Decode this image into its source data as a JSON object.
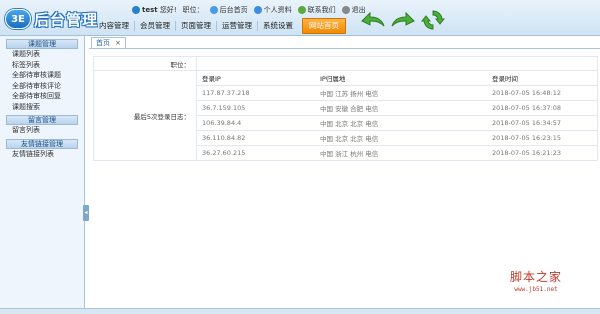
{
  "app": {
    "logo_mark": "3E",
    "logo_text": "后台管理"
  },
  "userbar": {
    "username": "test",
    "greeting": "您好!",
    "role_label": "职位：",
    "home_link": "后台首页",
    "profile_link": "个人资料",
    "contact_link": "联系我们",
    "logout_link": "退出"
  },
  "nav": {
    "items": [
      "内容管理",
      "会员管理",
      "页面管理",
      "运营管理",
      "系统设置"
    ],
    "site_button": "网站首页"
  },
  "toolbar": {
    "icons": [
      "back-arrow-icon",
      "forward-arrow-icon",
      "refresh-icon"
    ]
  },
  "sidebar": {
    "groups": [
      {
        "title": "课题管理",
        "links": [
          "课题列表",
          "标签列表",
          "全部待审核课题",
          "全部待审核评论",
          "全部待审核回复",
          "课题搜索"
        ]
      },
      {
        "title": "留言管理",
        "links": [
          "留言列表"
        ]
      },
      {
        "title": "友情链接管理",
        "links": [
          "友情链接列表"
        ]
      }
    ]
  },
  "tabs": [
    {
      "label": "首页",
      "close": "×"
    }
  ],
  "main": {
    "role_label": "职位：",
    "role_value": "",
    "logins_label": "最后5次登录日志：",
    "columns": [
      "登录IP",
      "IP归属地",
      "登录时间"
    ],
    "rows": [
      [
        "117.87.37.218",
        "中国 江苏 扬州 电信",
        "2018-07-05 16:48:12"
      ],
      [
        "36.7.159.105",
        "中国 安徽 合肥 电信",
        "2018-07-05 16:37:08"
      ],
      [
        "106.39.84.4",
        "中国 北京 北京 电信",
        "2018-07-05 16:34:57"
      ],
      [
        "36.110.84.82",
        "中国 北京 北京 电信",
        "2018-07-05 16:23:15"
      ],
      [
        "36.27.60.215",
        "中国 浙江 杭州 电信",
        "2018-07-05 16:21:23"
      ]
    ]
  },
  "watermark": {
    "title": "脚本之家",
    "url": "www.jb51.net"
  },
  "colors": {
    "accent": "#1c6fc2",
    "site_button": "#f08a00",
    "watermark": "#c0392b"
  }
}
